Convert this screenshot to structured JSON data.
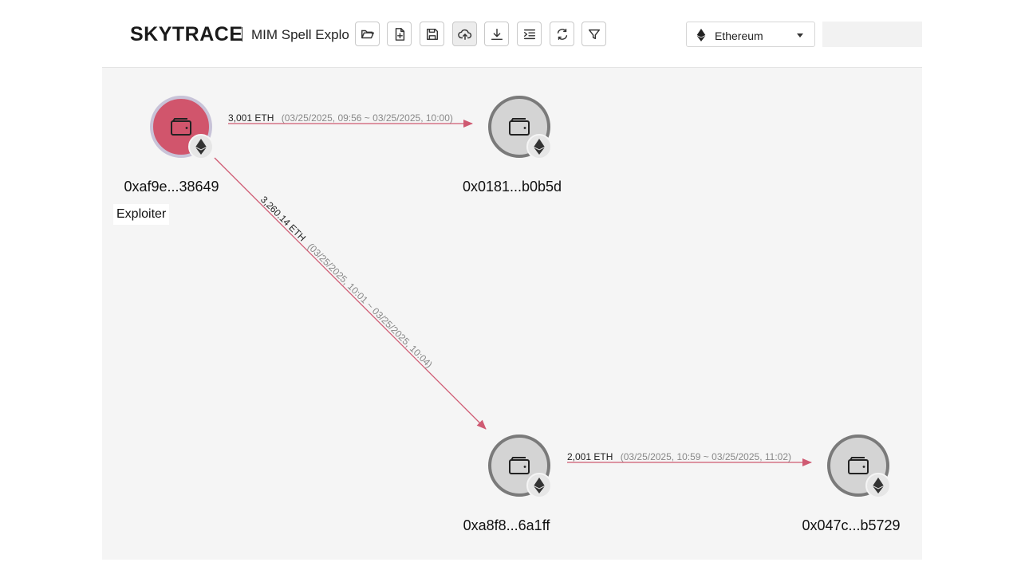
{
  "header": {
    "brand": "SKYTRACE",
    "project_name": "MIM Spell Explo",
    "toolbar": [
      {
        "icon": "folder-open-icon"
      },
      {
        "icon": "new-file-icon"
      },
      {
        "icon": "save-icon"
      },
      {
        "icon": "cloud-upload-icon"
      },
      {
        "icon": "download-icon"
      },
      {
        "icon": "list-indent-icon"
      },
      {
        "icon": "refresh-icon"
      },
      {
        "icon": "filter-icon"
      }
    ],
    "chain_select": {
      "value": "Ethereum",
      "icon": "ethereum-icon"
    },
    "search": {
      "value": "",
      "placeholder": ""
    }
  },
  "graph": {
    "nodes": [
      {
        "address": "0xaf9e...38649",
        "tag": "Exploiter",
        "type": "exploiter"
      },
      {
        "address": "0x0181...b0b5d"
      },
      {
        "address": "0xa8f8...6a1ff"
      },
      {
        "address": "0x047c...b5729"
      }
    ],
    "edges": [
      {
        "amount": "3,001 ETH",
        "time": "(03/25/2025, 09:56 ~ 03/25/2025, 10:00)"
      },
      {
        "amount": "3,260.14 ETH",
        "time": "(03/25/2025, 10:01 ~ 03/25/2025, 10:04)"
      },
      {
        "amount": "2,001 ETH",
        "time": "(03/25/2025, 10:59 ~ 03/25/2025, 11:02)"
      }
    ]
  },
  "colors": {
    "exploiter_node": "#d1556c",
    "edge": "#cf5a72",
    "node": "#d4d4d4"
  }
}
